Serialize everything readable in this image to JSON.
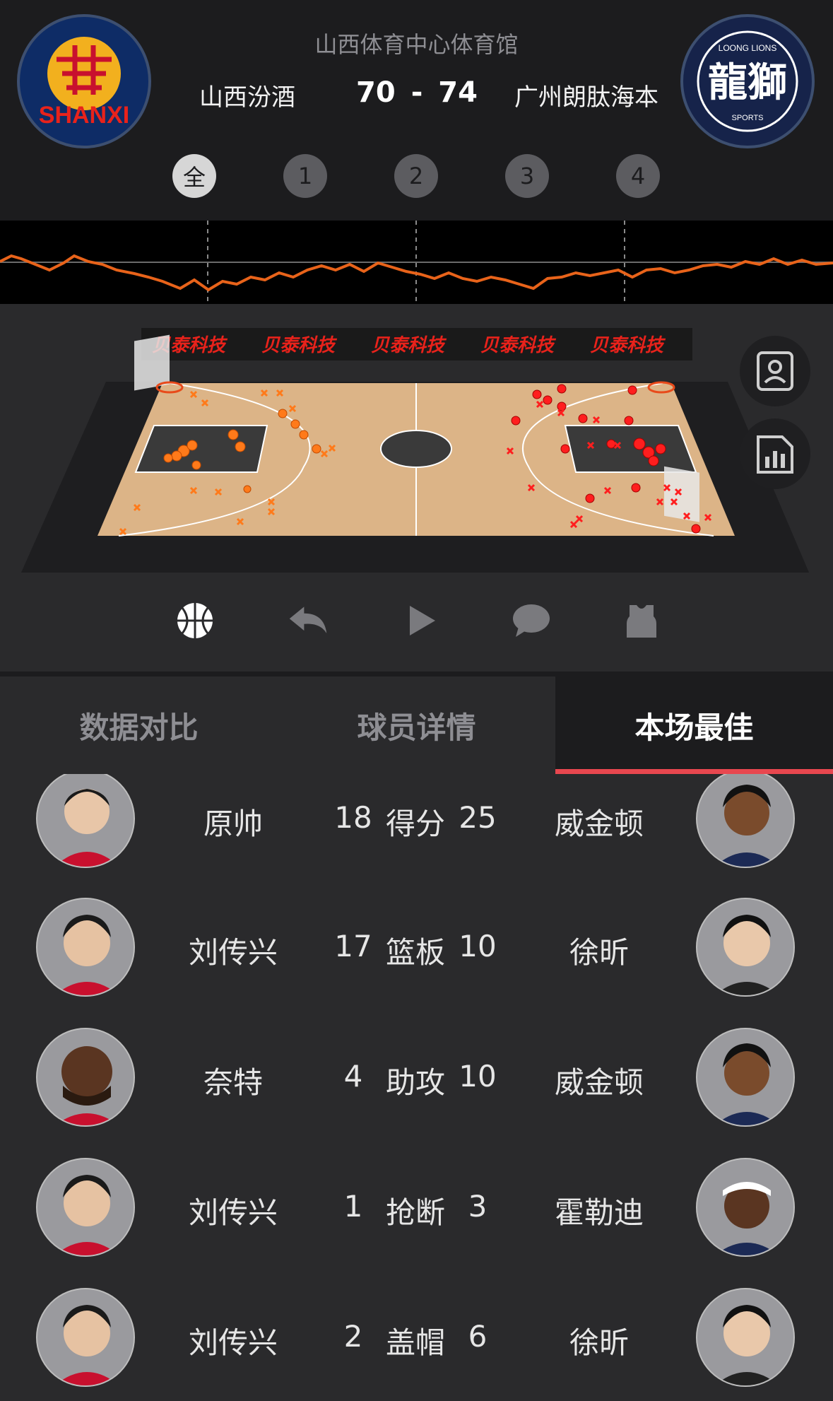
{
  "header": {
    "venue": "山西体育中心体育馆",
    "home_team": "山西汾酒",
    "away_team": "广州朗肽海本",
    "home_score": "70",
    "separator": "-",
    "away_score": "74",
    "home_logo_text": "SHANXI",
    "away_logo_text": "龍獅",
    "away_logo_sub": "LOONG LIONS",
    "away_logo_sub2": "SPORTS"
  },
  "quarters": [
    {
      "label": "全",
      "active": true
    },
    {
      "label": "1",
      "active": false
    },
    {
      "label": "2",
      "active": false
    },
    {
      "label": "3",
      "active": false
    },
    {
      "label": "4",
      "active": false
    }
  ],
  "court": {
    "sponsor": "贝泰科技",
    "home_color": "#ff7a1a",
    "away_color": "#ff1e1e"
  },
  "side_buttons": [
    "player-card-icon",
    "stats-chart-icon"
  ],
  "toolbar": [
    "basketball-icon",
    "undo-icon",
    "play-icon",
    "comment-icon",
    "jersey-icon"
  ],
  "tabs": [
    {
      "label": "数据对比",
      "active": false
    },
    {
      "label": "球员详情",
      "active": false
    },
    {
      "label": "本场最佳",
      "active": true
    }
  ],
  "best": [
    {
      "home_player": "原帅",
      "home_value": "18",
      "stat": "得分",
      "away_value": "25",
      "away_player": "威金顿"
    },
    {
      "home_player": "刘传兴",
      "home_value": "17",
      "stat": "篮板",
      "away_value": "10",
      "away_player": "徐昕"
    },
    {
      "home_player": "奈特",
      "home_value": "4",
      "stat": "助攻",
      "away_value": "10",
      "away_player": "威金顿"
    },
    {
      "home_player": "刘传兴",
      "home_value": "1",
      "stat": "抢断",
      "away_value": "3",
      "away_player": "霍勒迪"
    },
    {
      "home_player": "刘传兴",
      "home_value": "2",
      "stat": "盖帽",
      "away_value": "6",
      "away_player": "徐昕"
    }
  ],
  "colors": {
    "accent": "#e8474f",
    "trend_line": "#e8631a"
  }
}
